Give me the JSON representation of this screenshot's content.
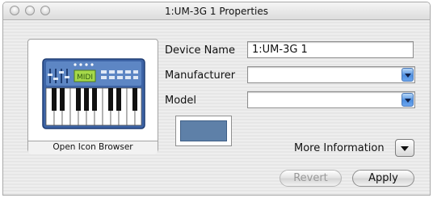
{
  "window": {
    "title": "1:UM-3G 1 Properties"
  },
  "icon_panel": {
    "caption": "Open Icon Browser",
    "icon": "midi-keyboard-icon",
    "display_text": "MIDI"
  },
  "form": {
    "device_name_label": "Device Name",
    "device_name_value": "1:UM-3G 1",
    "manufacturer_label": "Manufacturer",
    "manufacturer_value": "",
    "model_label": "Model",
    "model_value": ""
  },
  "color_well": {
    "color": "#5e80a8"
  },
  "more_information": {
    "label": "More Information"
  },
  "buttons": {
    "revert_label": "Revert",
    "apply_label": "Apply"
  }
}
